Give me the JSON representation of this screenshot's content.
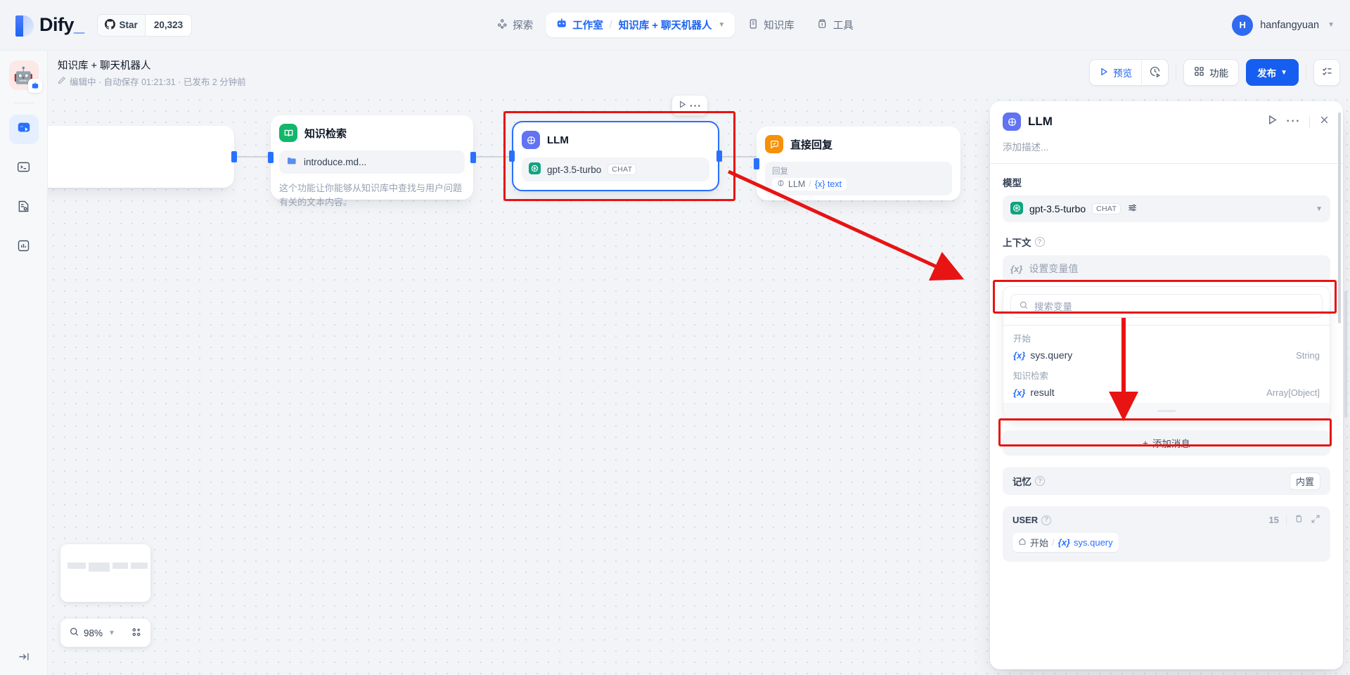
{
  "topbar": {
    "logo_text": "Dify",
    "logo_cursor": "_",
    "star_label": "Star",
    "star_count": "20,323",
    "nav": [
      {
        "label": "探索",
        "icon": "explore-icon",
        "active": false
      },
      {
        "label": "工作室",
        "icon": "studio-icon",
        "active": true
      },
      {
        "label": "知识库",
        "icon": "knowledge-icon",
        "active": false
      },
      {
        "label": "工具",
        "icon": "tools-icon",
        "active": false
      }
    ],
    "separator": "/",
    "current_app": "知识库 + 聊天机器人",
    "user": {
      "initial": "H",
      "name": "hanfangyuan"
    }
  },
  "rail": {
    "items": [
      {
        "name": "app-avatar",
        "glyph": "🤖"
      },
      {
        "name": "orchestrate",
        "glyph": "⤭"
      },
      {
        "name": "api-access",
        "glyph": "⌨"
      },
      {
        "name": "logs-annotations",
        "glyph": "🗒"
      },
      {
        "name": "monitoring",
        "glyph": "📊"
      }
    ],
    "collapse_label": "收起"
  },
  "subheader": {
    "title": "知识库 + 聊天机器人",
    "status_icon": "pencil-icon",
    "meta": "编辑中 · 自动保存 01:21:31 · 已发布 2 分钟前",
    "preview_label": "预览",
    "features_label": "功能",
    "publish_label": "发布"
  },
  "canvas": {
    "nodes": [
      {
        "id": "start",
        "title": "",
        "icon": "start-icon",
        "icon_color": "#2970ff"
      },
      {
        "id": "knowledge-retrieval",
        "title": "知识检索",
        "icon": "book-icon",
        "icon_color": "#12b76a",
        "sub_label": "introduce.md...",
        "desc": "这个功能让你能够从知识库中查找与用户问题有关的文本内容。"
      },
      {
        "id": "llm",
        "title": "LLM",
        "icon": "llm-icon",
        "icon_color": "#6172f3",
        "model": "gpt-3.5-turbo",
        "model_badge": "CHAT"
      },
      {
        "id": "answer",
        "title": "直接回复",
        "icon": "answer-icon",
        "icon_color": "#f79009",
        "sub_label": "回复",
        "ref_node": "LLM",
        "ref_var": "{x} text"
      }
    ],
    "zoom_level": "98%",
    "search_icon": "search-icon",
    "organize_icon": "organize-nodes-icon"
  },
  "panel": {
    "title": "LLM",
    "description_placeholder": "添加描述...",
    "model_section_label": "模型",
    "model_name": "gpt-3.5-turbo",
    "model_badge": "CHAT",
    "context_label": "上下文",
    "context_placeholder": "设置变量值",
    "search_placeholder": "搜索变量",
    "var_groups": [
      {
        "group": "开始",
        "items": [
          {
            "name": "sys.query",
            "type": "String"
          }
        ]
      },
      {
        "group": "知识检索",
        "items": [
          {
            "name": "result",
            "type": "Array[Object]"
          }
        ]
      }
    ],
    "add_message_label": "添加消息",
    "memory_label": "记忆",
    "memory_value": "内置",
    "user_role_label": "USER",
    "user_char_count": "15",
    "user_ref_node": "开始",
    "user_ref_var": "sys.query"
  },
  "colors": {
    "accent": "#155eef",
    "highlight": "#e81313",
    "green": "#12b76a",
    "orange": "#f79009",
    "indigo": "#6172f3"
  }
}
